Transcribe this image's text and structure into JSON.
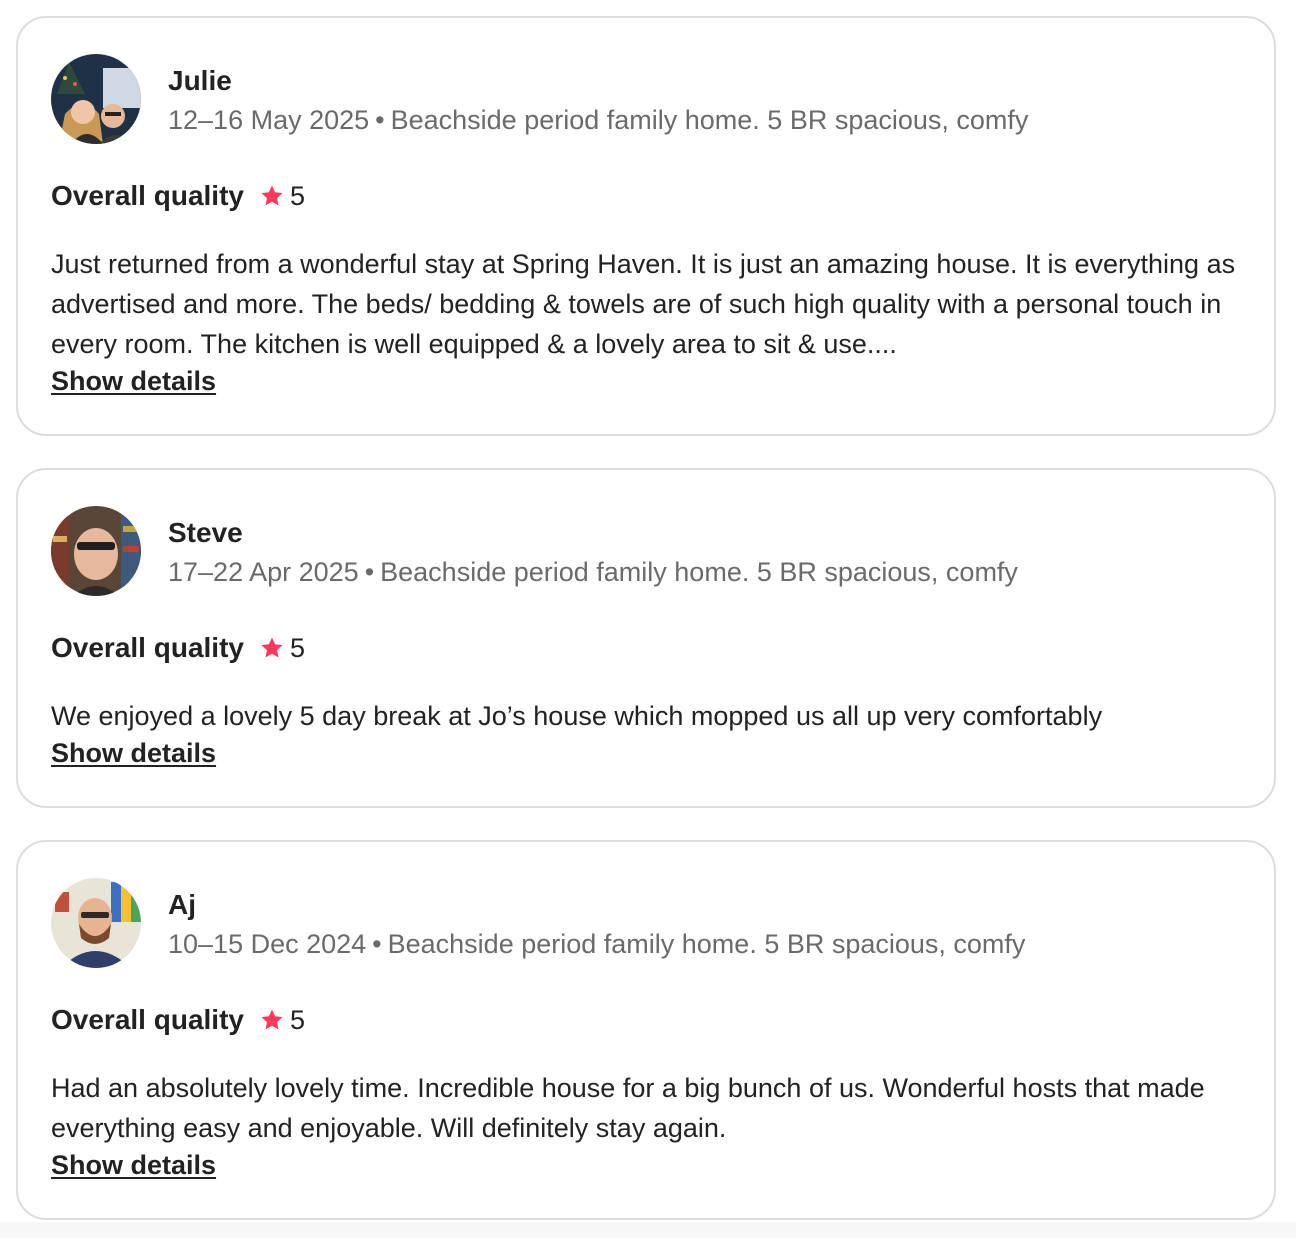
{
  "reviews": [
    {
      "name": "Julie",
      "dates": "12–16 May 2025",
      "separator": "•",
      "listing": "Beachside period family home. 5 BR spacious, comfy",
      "rating_label": "Overall quality",
      "rating": "5",
      "text": "Just returned from a wonderful stay at Spring Haven. It is just an amazing house. It is everything as advertised and more. The beds/ bedding & towels are of such high quality with a personal touch in every room. The kitchen is well equipped & a lovely area to sit & use....",
      "show_details": "Show details"
    },
    {
      "name": "Steve",
      "dates": "17–22 Apr 2025",
      "separator": "•",
      "listing": "Beachside period family home. 5 BR spacious, comfy",
      "rating_label": "Overall quality",
      "rating": "5",
      "text": "We enjoyed a lovely 5 day break at Jo’s house which mopped us all up very comfortably",
      "show_details": "Show details"
    },
    {
      "name": "Aj",
      "dates": "10–15 Dec 2024",
      "separator": "•",
      "listing": "Beachside period family home. 5 BR spacious, comfy",
      "rating_label": "Overall quality",
      "rating": "5",
      "text": "Had an absolutely lovely time. Incredible house for a big bunch of us. Wonderful hosts that made everything easy and enjoyable. Will definitely stay again.",
      "show_details": "Show details"
    }
  ],
  "colors": {
    "star": "#ff385c",
    "text_primary": "#222222",
    "text_secondary": "#6a6a6a",
    "card_border": "#dddddd"
  },
  "icons": {
    "rating": "star-icon"
  }
}
